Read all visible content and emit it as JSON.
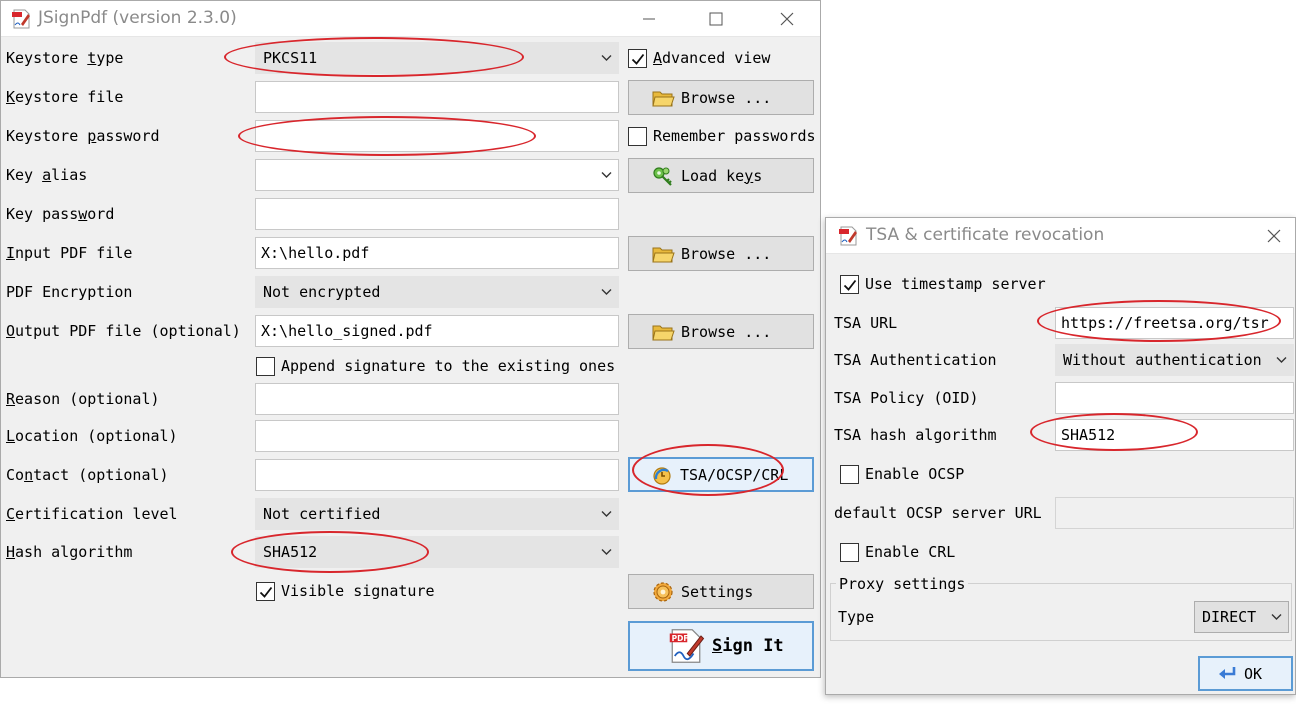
{
  "main": {
    "title": "JSignPdf (version 2.3.0)",
    "labels": {
      "keystore_type": [
        "Keystore ",
        "t",
        "ype"
      ],
      "keystore_file": [
        "",
        "K",
        "eystore file"
      ],
      "keystore_password": [
        "Keystore ",
        "p",
        "assword"
      ],
      "key_alias": [
        "Key ",
        "a",
        "lias"
      ],
      "key_password": [
        "Key pass",
        "w",
        "ord"
      ],
      "input_pdf": [
        "",
        "I",
        "nput PDF file"
      ],
      "pdf_encryption": [
        "PDF Encryption",
        "",
        ""
      ],
      "output_pdf": [
        "",
        "O",
        "utput PDF file (optional)"
      ],
      "reason": [
        "",
        "R",
        "eason (optional)"
      ],
      "location": [
        "",
        "L",
        "ocation (optional)"
      ],
      "contact": [
        "Co",
        "n",
        "tact (optional)"
      ],
      "cert_level": [
        "",
        "C",
        "ertification level"
      ],
      "hash_algorithm": [
        "",
        "H",
        "ash algorithm"
      ]
    },
    "values": {
      "keystore_type": "PKCS11",
      "keystore_file": "",
      "keystore_password": "",
      "key_alias": "",
      "key_password": "",
      "input_pdf": "X:\\hello.pdf",
      "pdf_encryption": "Not encrypted",
      "output_pdf": "X:\\hello_signed.pdf",
      "reason": "",
      "location": "",
      "contact": "",
      "cert_level": "Not certified",
      "hash_algorithm": "SHA512"
    },
    "checkboxes": {
      "advanced_view": {
        "pre": "",
        "acc": "A",
        "post": "dvanced view",
        "checked": true
      },
      "remember_passwords": {
        "pre": "Remember passwords",
        "acc": "",
        "post": "",
        "checked": false
      },
      "append_signature": {
        "pre": "Append signature to the existing ones",
        "acc": "",
        "post": "",
        "checked": false
      },
      "visible_signature": {
        "pre": "Visible signature",
        "acc": "",
        "post": "",
        "checked": true
      }
    },
    "buttons": {
      "browse": "Browse ...",
      "load_keys": [
        "Load ke",
        "y",
        "s"
      ],
      "tsa": "TSA/OCSP/CRL",
      "settings": "Settings",
      "sign_it": [
        "",
        "S",
        "ign It"
      ]
    }
  },
  "tsa": {
    "title": "TSA & certificate revocation",
    "use_timestamp": {
      "label": "Use timestamp server",
      "checked": true
    },
    "labels": {
      "tsa_url": "TSA URL",
      "tsa_auth": "TSA Authentication",
      "tsa_policy": "TSA Policy (OID)",
      "tsa_hash": "TSA hash algorithm",
      "ocsp_url": "default OCSP server URL",
      "proxy_type": "Type"
    },
    "values": {
      "tsa_url": "https://freetsa.org/tsr",
      "tsa_auth": "Without authentication",
      "tsa_policy": "",
      "tsa_hash": "SHA512",
      "ocsp_url": "",
      "proxy_type": "DIRECT"
    },
    "enable_ocsp": {
      "label": "Enable OCSP",
      "checked": false
    },
    "enable_crl": {
      "label": "Enable CRL",
      "checked": false
    },
    "proxy_group": "Proxy settings",
    "ok_button": "OK"
  },
  "colors": {
    "annotation": "#d8262c",
    "focus_border": "#5b9bd5"
  }
}
